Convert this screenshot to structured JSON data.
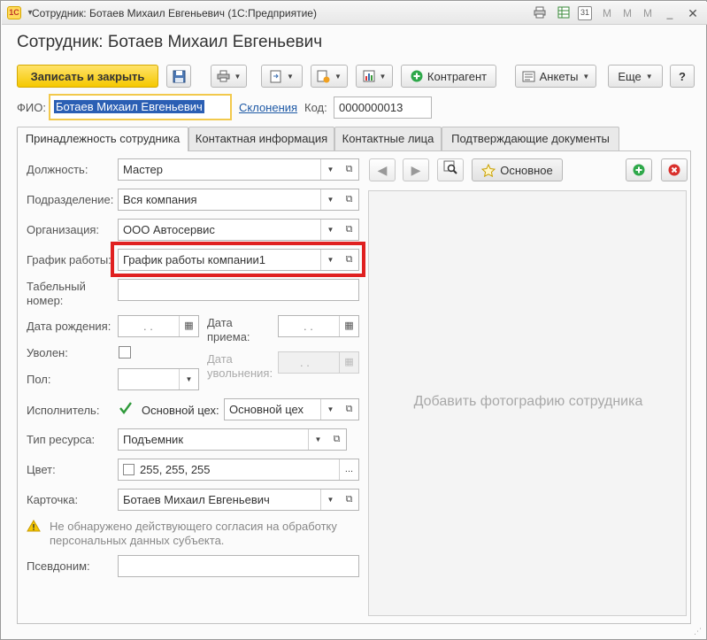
{
  "window": {
    "title": "Сотрудник: Ботаев Михаил Евгеньевич  (1С:Предприятие)",
    "logo_text": "1С"
  },
  "heading": "Сотрудник: Ботаев Михаил Евгеньевич",
  "toolbar": {
    "save_close": "Записать и закрыть",
    "kontragent": "Контрагент",
    "ankety": "Анкеты",
    "eshche": "Еще",
    "help": "?"
  },
  "header_fields": {
    "fio_label": "ФИО:",
    "fio_value": "Ботаев Михаил Евгеньевич",
    "sklon_link": "Склонения",
    "kod_label": "Код:",
    "kod_value": "0000000013"
  },
  "tabs": [
    {
      "label": "Принадлежность сотрудника",
      "active": true
    },
    {
      "label": "Контактная информация",
      "active": false
    },
    {
      "label": "Контактные лица",
      "active": false
    },
    {
      "label": "Подтверждающие документы",
      "active": false
    }
  ],
  "form": {
    "dolzhnost": {
      "label": "Должность:",
      "value": "Мастер"
    },
    "podrazdelenie": {
      "label": "Подразделение:",
      "value": "Вся компания"
    },
    "organizaciya": {
      "label": "Организация:",
      "value": "ООО Автосервис"
    },
    "grafik": {
      "label": "График работы:",
      "value": "График работы компании1"
    },
    "tabelny": {
      "label": "Табельный номер:",
      "value": ""
    },
    "data_rozhd": {
      "label": "Дата рождения:",
      "value": " .  ."
    },
    "data_priema": {
      "label": "Дата приема:",
      "value": " .  ."
    },
    "uvolen": {
      "label": "Уволен:",
      "checked": false
    },
    "data_uvoln": {
      "label": "Дата увольнения:",
      "value": " .  ."
    },
    "pol": {
      "label": "Пол:",
      "value": ""
    },
    "ispolnitel": {
      "label": "Исполнитель:",
      "checked": true
    },
    "osnovnoy_ceh": {
      "label": "Основной цех:",
      "value": "Основной цех"
    },
    "tip_resursa": {
      "label": "Тип ресурса:",
      "value": "Подъемник"
    },
    "cvet": {
      "label": "Цвет:",
      "value": "255, 255, 255",
      "button": "..."
    },
    "kartochka": {
      "label": "Карточка:",
      "value": "Ботаев Михаил Евгеньевич"
    },
    "warning": "Не обнаружено действующего согласия на обработку персональных данных субъекта.",
    "psevdonim": {
      "label": "Псевдоним:",
      "value": ""
    }
  },
  "photo": {
    "osnovnoe": "Основное",
    "placeholder": "Добавить фотографию сотрудника"
  },
  "colors": {
    "accent_yellow": "#f5c800",
    "highlight_red": "#e02020",
    "link_blue": "#1f5aa6",
    "add_green": "#2ea84a",
    "delete_red": "#d9302c"
  }
}
